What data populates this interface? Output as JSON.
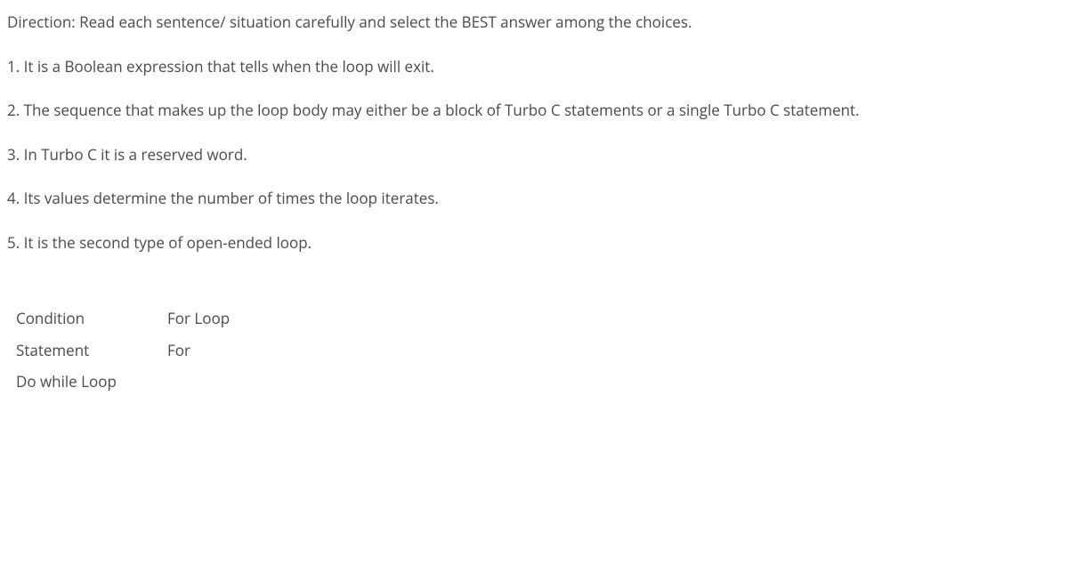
{
  "direction": "Direction: Read each sentence/ situation carefully and select the BEST answer among the choices.",
  "questions": {
    "q1": "1. It is a Boolean expression that tells when the loop will exit.",
    "q2": "2. The sequence that makes up the loop body may either be a block of Turbo C statements or a single Turbo C statement.",
    "q3": "3. In Turbo C it is a reserved word.",
    "q4": "4. Its values determine the number of times the loop iterates.",
    "q5": "5. It is the second type of open-ended loop."
  },
  "answers": {
    "row1col1": "Condition",
    "row1col2": "For Loop",
    "row2col1": "Statement",
    "row2col2": "For",
    "row3col1": "Do while Loop"
  }
}
